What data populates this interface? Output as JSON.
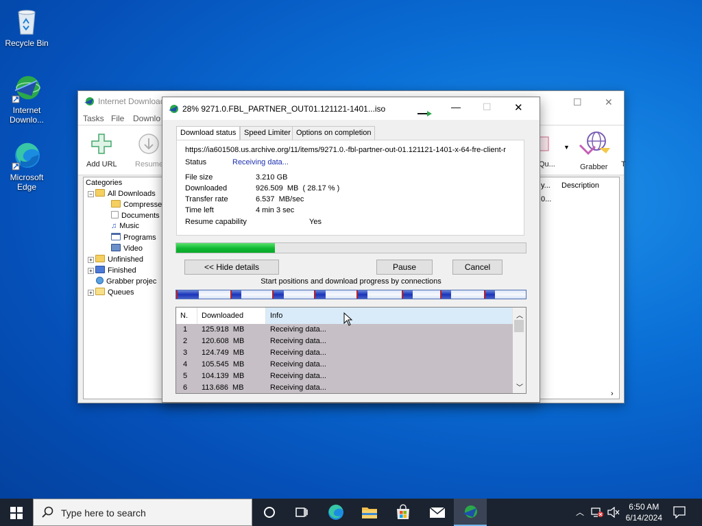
{
  "desktop": {
    "icons": [
      {
        "label": "Recycle Bin"
      },
      {
        "label": "Internet Downlo..."
      },
      {
        "label": "Microsoft Edge"
      }
    ]
  },
  "main_window": {
    "title": "Internet Download",
    "menu": [
      "Tasks",
      "File",
      "Downlo"
    ],
    "toolbar": {
      "add_url": "Add URL",
      "resume": "Resume",
      "qu": "Qu...",
      "grabber": "Grabber",
      "t": "T"
    },
    "categories": {
      "header": "Categories",
      "items": [
        "All Downloads",
        "Compresse",
        "Documents",
        "Music",
        "Programs",
        "Video",
        "Unfinished",
        "Finished",
        "Grabber projec",
        "Queues"
      ]
    },
    "list": {
      "col_short": "y...",
      "col_description": "Description",
      "first_cell": "0..."
    }
  },
  "dialog": {
    "title": "28% 9271.0.FBL_PARTNER_OUT01.121121-1401...iso",
    "tabs": [
      "Download status",
      "Speed Limiter",
      "Options on completion"
    ],
    "url": "https://ia601508.us.archive.org/11/items/9271.0.-fbl-partner-out-01.121121-1401-x-64-fre-client-r",
    "status_label": "Status",
    "status_value": "Receiving data...",
    "file_size_label": "File size",
    "file_size_value": "3.210  GB",
    "downloaded_label": "Downloaded",
    "downloaded_value": "926.509  MB  ( 28.17 % )",
    "transfer_rate_label": "Transfer rate",
    "transfer_rate_value": "6.537  MB/sec",
    "time_left_label": "Time left",
    "time_left_value": "4 min 3 sec",
    "resume_label": "Resume capability",
    "resume_value": "Yes",
    "progress_fraction": 0.2817,
    "buttons": {
      "hide_details": "<< Hide details",
      "pause": "Pause",
      "cancel": "Cancel"
    },
    "connections_label": "Start positions and download progress by connections",
    "connection_segments": [
      0.0,
      0.155,
      0.275,
      0.395,
      0.515,
      0.645,
      0.755,
      0.88
    ],
    "table": {
      "headers": [
        "N.",
        "Downloaded",
        "Info"
      ],
      "rows": [
        {
          "n": "1",
          "downloaded": "125.918  MB",
          "info": "Receiving data..."
        },
        {
          "n": "2",
          "downloaded": "120.608  MB",
          "info": "Receiving data..."
        },
        {
          "n": "3",
          "downloaded": "124.749  MB",
          "info": "Receiving data..."
        },
        {
          "n": "4",
          "downloaded": "105.545  MB",
          "info": "Receiving data..."
        },
        {
          "n": "5",
          "downloaded": "104.139  MB",
          "info": "Receiving data..."
        },
        {
          "n": "6",
          "downloaded": "113.686  MB",
          "info": "Receiving data..."
        }
      ]
    }
  },
  "taskbar": {
    "search_placeholder": "Type here to search",
    "time": "6:50 AM",
    "date": "6/14/2024"
  },
  "colors": {
    "status_blue": "#1a2eb0",
    "progress_green": "#12b832",
    "taskbar": "#1b2330"
  }
}
